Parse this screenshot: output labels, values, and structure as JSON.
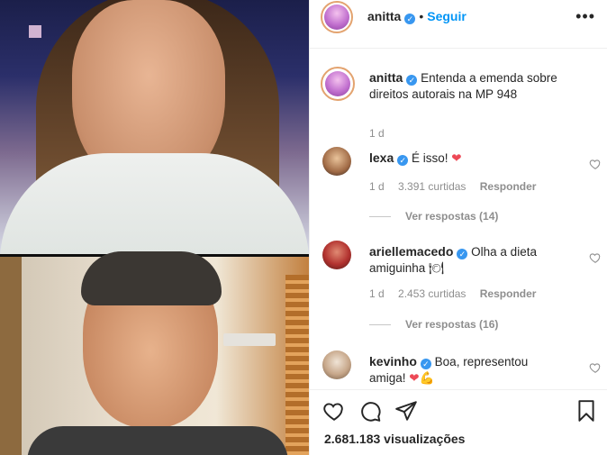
{
  "header": {
    "username": "anitta",
    "separator": "•",
    "follow_label": "Seguir",
    "more_label": "•••"
  },
  "caption": {
    "username": "anitta",
    "text": "Entenda a emenda sobre direitos autorais na MP 948",
    "time": "1 d"
  },
  "comments": [
    {
      "username": "lexa",
      "text": "É isso!",
      "emoji": "❤",
      "time": "1 d",
      "likes": "3.391 curtidas",
      "reply_label": "Responder",
      "view_replies": "Ver respostas (14)"
    },
    {
      "username": "ariellemacedo",
      "text": "Olha a dieta amiguinha",
      "emoji": "🍽",
      "time": "1 d",
      "likes": "2.453 curtidas",
      "reply_label": "Responder",
      "view_replies": "Ver respostas (16)"
    },
    {
      "username": "kevinho",
      "text": "Boa, representou amiga!",
      "emoji": "❤💪",
      "time": "",
      "likes": "",
      "reply_label": "",
      "view_replies": ""
    }
  ],
  "footer": {
    "views": "2.681.183 visualizações"
  },
  "colors": {
    "accent": "#0095f6",
    "verified": "#3897f0",
    "heart": "#ed4956",
    "muted": "#8e8e8e"
  },
  "icons": [
    "verified-icon",
    "more-icon",
    "heart-icon",
    "comment-icon",
    "share-icon",
    "save-icon"
  ]
}
